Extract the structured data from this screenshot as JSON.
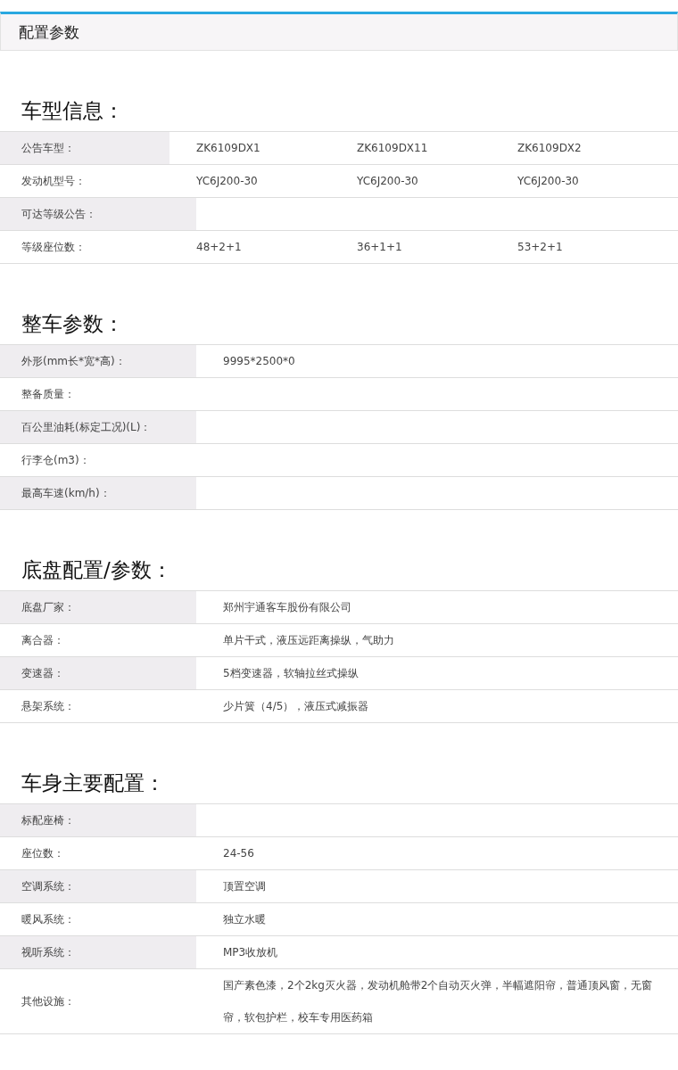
{
  "header": {
    "title": "配置参数"
  },
  "sections": [
    {
      "title": "车型信息：",
      "rows": [
        {
          "label": "公告车型：",
          "values": [
            "ZK6109DX1",
            "ZK6109DX11",
            "ZK6109DX2"
          ]
        },
        {
          "label": "发动机型号：",
          "values": [
            "YC6J200-30",
            "YC6J200-30",
            "YC6J200-30"
          ]
        },
        {
          "label": "可达等级公告："
        },
        {
          "label": "等级座位数：",
          "values": [
            "48+2+1",
            "36+1+1",
            "53+2+1"
          ]
        }
      ]
    },
    {
      "title": "整车参数：",
      "rows": [
        {
          "label": "外形(mm长*宽*高)：",
          "values": [
            "9995*2500*0"
          ]
        },
        {
          "label": "整备质量："
        },
        {
          "label": "百公里油耗(标定工况)(L)："
        },
        {
          "label": "行李仓(m3)："
        },
        {
          "label": "最高车速(km/h)："
        }
      ]
    },
    {
      "title": "底盘配置/参数：",
      "rows": [
        {
          "label": "底盘厂家：",
          "values": [
            "郑州宇通客车股份有限公司"
          ]
        },
        {
          "label": "离合器：",
          "values": [
            "单片干式，液压远距离操纵，气助力"
          ]
        },
        {
          "label": "变速器：",
          "values": [
            "5档变速器，软轴拉丝式操纵"
          ]
        },
        {
          "label": "悬架系统：",
          "values": [
            "少片簧（4/5），液压式减振器"
          ]
        }
      ]
    },
    {
      "title": "车身主要配置：",
      "rows": [
        {
          "label": "标配座椅："
        },
        {
          "label": "座位数：",
          "values": [
            "24-56"
          ]
        },
        {
          "label": "空调系统：",
          "values": [
            "顶置空调"
          ]
        },
        {
          "label": "暖风系统：",
          "values": [
            "独立水暖"
          ]
        },
        {
          "label": "视听系统：",
          "values": [
            "MP3收放机"
          ]
        },
        {
          "label": "其他设施：",
          "values": [
            "国产素色漆，2个2kg灭火器，发动机舱带2个自动灭火弹，半幅遮阳帘，普通顶风窗，无窗帘，软包护栏，校车专用医药箱"
          ]
        }
      ]
    }
  ]
}
